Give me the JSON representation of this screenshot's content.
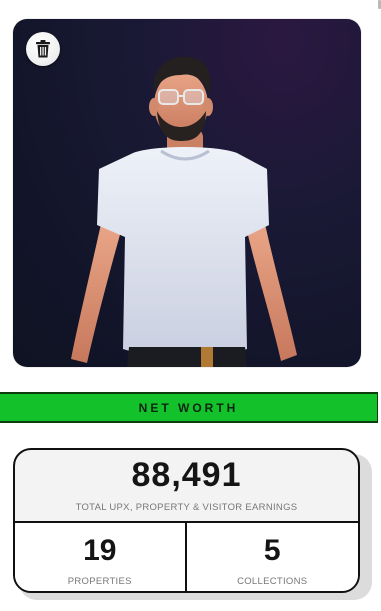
{
  "avatar": {
    "background": "#121529",
    "delete_icon": "trash-icon"
  },
  "net_worth": {
    "label": "NET WORTH",
    "color": "#13c12a"
  },
  "stats": {
    "total": {
      "value": "88,491",
      "caption": "TOTAL UPX, PROPERTY & VISITOR EARNINGS"
    },
    "properties": {
      "value": "19",
      "caption": "PROPERTIES"
    },
    "collections": {
      "value": "5",
      "caption": "COLLECTIONS"
    }
  }
}
